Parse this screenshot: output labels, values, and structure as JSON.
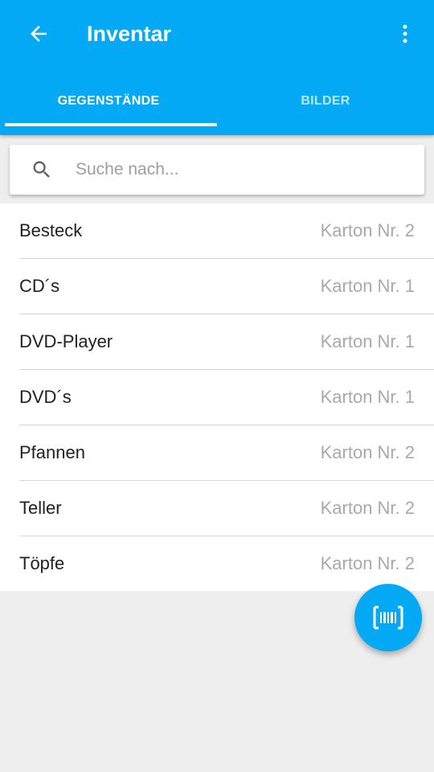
{
  "theme": {
    "primary": "#03a9f4",
    "background": "#eeeeee",
    "text_primary": "#212121",
    "text_secondary": "#a9a9a9"
  },
  "toolbar": {
    "back_icon": "arrow-back-icon",
    "title": "Inventar",
    "menu_icon": "more-vert-icon"
  },
  "tabs": [
    {
      "label": "GEGENSTÄNDE",
      "active": true
    },
    {
      "label": "BILDER",
      "active": false
    }
  ],
  "search": {
    "icon": "search-icon",
    "placeholder": "Suche nach...",
    "value": ""
  },
  "items": [
    {
      "name": "Besteck",
      "box": "Karton Nr. 2"
    },
    {
      "name": "CD´s",
      "box": "Karton Nr. 1"
    },
    {
      "name": "DVD-Player",
      "box": "Karton Nr. 1"
    },
    {
      "name": "DVD´s",
      "box": "Karton Nr. 1"
    },
    {
      "name": "Pfannen",
      "box": "Karton Nr. 2"
    },
    {
      "name": "Teller",
      "box": "Karton Nr. 2"
    },
    {
      "name": "Töpfe",
      "box": "Karton Nr. 2"
    }
  ],
  "fab": {
    "icon": "barcode-scan-icon"
  }
}
